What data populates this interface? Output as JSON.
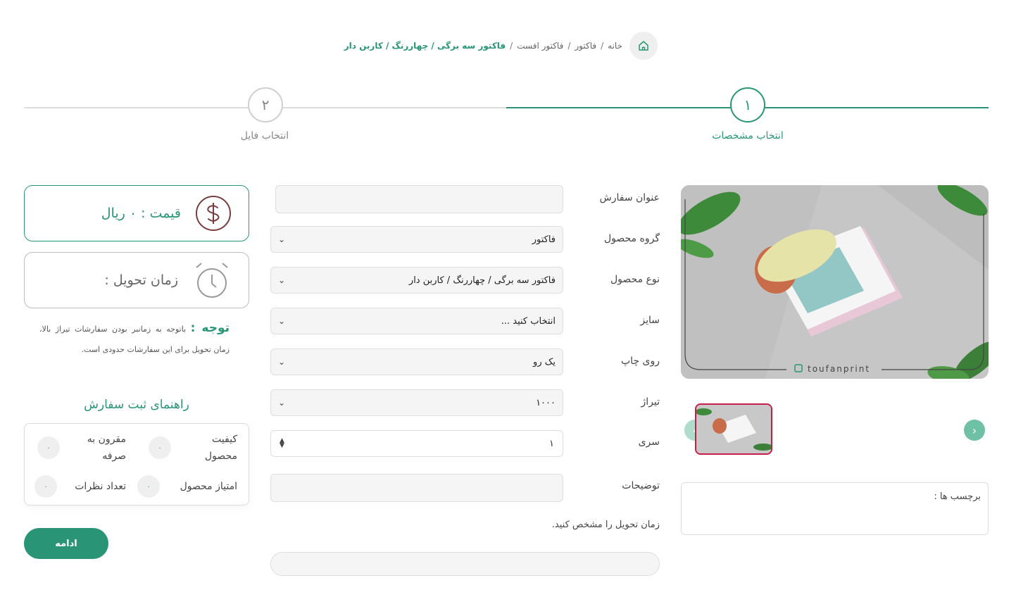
{
  "breadcrumb": {
    "home": "خانه",
    "items": [
      "فاکتور",
      "فاکتور افست"
    ],
    "active": "فاکتور سه برگی / چهاررنگ / کاربن دار",
    "separator": "/"
  },
  "steps": [
    {
      "number": "۱",
      "label": "انتخاب مشخصات",
      "state": "active"
    },
    {
      "number": "۲",
      "label": "انتخاب فایل",
      "state": "inactive"
    }
  ],
  "product": {
    "watermark": "toufanprint",
    "tags_label": "برچسب ها :"
  },
  "form": {
    "order_title": {
      "label": "عنوان سفارش",
      "value": ""
    },
    "product_group": {
      "label": "گروه محصول",
      "value": "فاکتور"
    },
    "product_type": {
      "label": "نوع محصول",
      "value": "فاکتور سه برگی / چهاررنگ / کاربن دار"
    },
    "size": {
      "label": "سایز",
      "value": "انتخاب کنید ..."
    },
    "print_side": {
      "label": "روی چاپ",
      "value": "یک رو"
    },
    "circulation": {
      "label": "تیراژ",
      "value": "۱۰۰۰"
    },
    "series": {
      "label": "سری",
      "value": "۱"
    },
    "description": {
      "label": "توضیحات",
      "value": ""
    },
    "delivery_note": "زمان تحویل را مشخص کنید."
  },
  "summary": {
    "price": "قیمت : ۰ ریال",
    "delivery": "زمان تحویل :",
    "notice_title": "توجه :",
    "notice_text": "باتوجه به زمانبر بودن سفارشات تیراژ بالا، زمان تحویل برای این سفارشات حدودی است."
  },
  "guide": {
    "title": "راهنمای ثبت سفارش",
    "items": [
      {
        "label": "کیفیت محصول",
        "value": "۰"
      },
      {
        "label": "مقرون به صرفه",
        "value": "۰"
      },
      {
        "label": "امتیاز محصول",
        "value": "۰"
      },
      {
        "label": "تعداد نظرات",
        "value": "۰"
      }
    ]
  },
  "actions": {
    "continue": "ادامه"
  },
  "colors": {
    "brand": "#2a9576",
    "thumb_border": "#c41e4a",
    "arrow": "#6fc1a5"
  }
}
